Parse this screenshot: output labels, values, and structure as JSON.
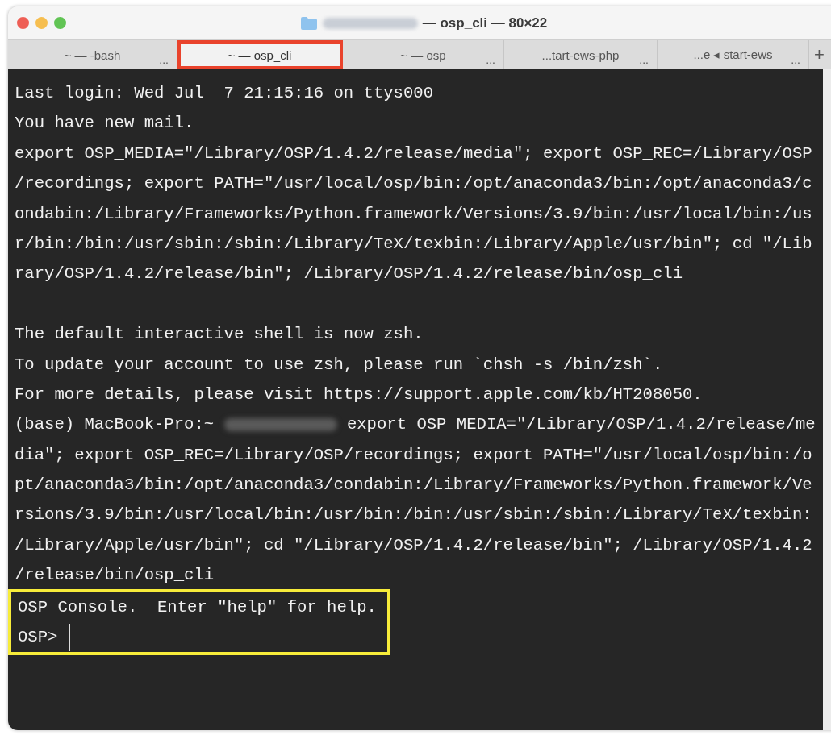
{
  "window": {
    "title": "— osp_cli — 80×22",
    "title_redacted": true
  },
  "tabs": [
    {
      "label": "~ — -bash",
      "indicator": "...",
      "selected": false,
      "annotated": false
    },
    {
      "label": "~ — osp_cli",
      "selected": true,
      "annotated": true
    },
    {
      "label": "~ — osp",
      "indicator": "...",
      "selected": false,
      "annotated": false
    },
    {
      "label": "...tart-ews-php",
      "indicator": "...",
      "selected": false,
      "annotated": false
    },
    {
      "label": "...e ◂ start-ews",
      "indicator": "...",
      "selected": false,
      "annotated": false
    }
  ],
  "new_tab_button": "+",
  "terminal": {
    "lines": [
      {
        "kind": "text",
        "text": "Last login: Wed Jul  7 21:15:16 on ttys000"
      },
      {
        "kind": "text",
        "text": "You have new mail."
      },
      {
        "kind": "text",
        "text": "export OSP_MEDIA=\"/Library/OSP/1.4.2/release/media\"; export OSP_REC=/Library/OSP"
      },
      {
        "kind": "text",
        "text": "/recordings; export PATH=\"/usr/local/osp/bin:/opt/anaconda3/bin:/opt/anaconda3/c"
      },
      {
        "kind": "text",
        "text": "ondabin:/Library/Frameworks/Python.framework/Versions/3.9/bin:/usr/local/bin:/us"
      },
      {
        "kind": "text",
        "text": "r/bin:/bin:/usr/sbin:/sbin:/Library/TeX/texbin:/Library/Apple/usr/bin\"; cd \"/Lib"
      },
      {
        "kind": "text",
        "text": "rary/OSP/1.4.2/release/bin\"; /Library/OSP/1.4.2/release/bin/osp_cli"
      },
      {
        "kind": "blank"
      },
      {
        "kind": "text",
        "text": "The default interactive shell is now zsh."
      },
      {
        "kind": "text",
        "text": "To update your account to use zsh, please run `chsh -s /bin/zsh`."
      },
      {
        "kind": "text",
        "text": "For more details, please visit https://support.apple.com/kb/HT208050."
      },
      {
        "kind": "prompt",
        "before": "(base) MacBook-Pro:~ ",
        "after": " export OSP_MEDIA=\"/Library/OSP/1.4.2/release/me"
      },
      {
        "kind": "text",
        "text": "dia\"; export OSP_REC=/Library/OSP/recordings; export PATH=\"/usr/local/osp/bin:/o"
      },
      {
        "kind": "text",
        "text": "pt/anaconda3/bin:/opt/anaconda3/condabin:/Library/Frameworks/Python.framework/Ve"
      },
      {
        "kind": "text",
        "text": "rsions/3.9/bin:/usr/local/bin:/usr/bin:/bin:/usr/sbin:/sbin:/Library/TeX/texbin:"
      },
      {
        "kind": "text",
        "text": "/Library/Apple/usr/bin\"; cd \"/Library/OSP/1.4.2/release/bin\"; /Library/OSP/1.4.2"
      },
      {
        "kind": "text",
        "text": "/release/bin/osp_cli"
      }
    ],
    "highlighted_lines": [
      {
        "kind": "text",
        "text": "OSP Console.  Enter \"help\" for help."
      },
      {
        "kind": "input",
        "prompt": "OSP>"
      }
    ]
  }
}
